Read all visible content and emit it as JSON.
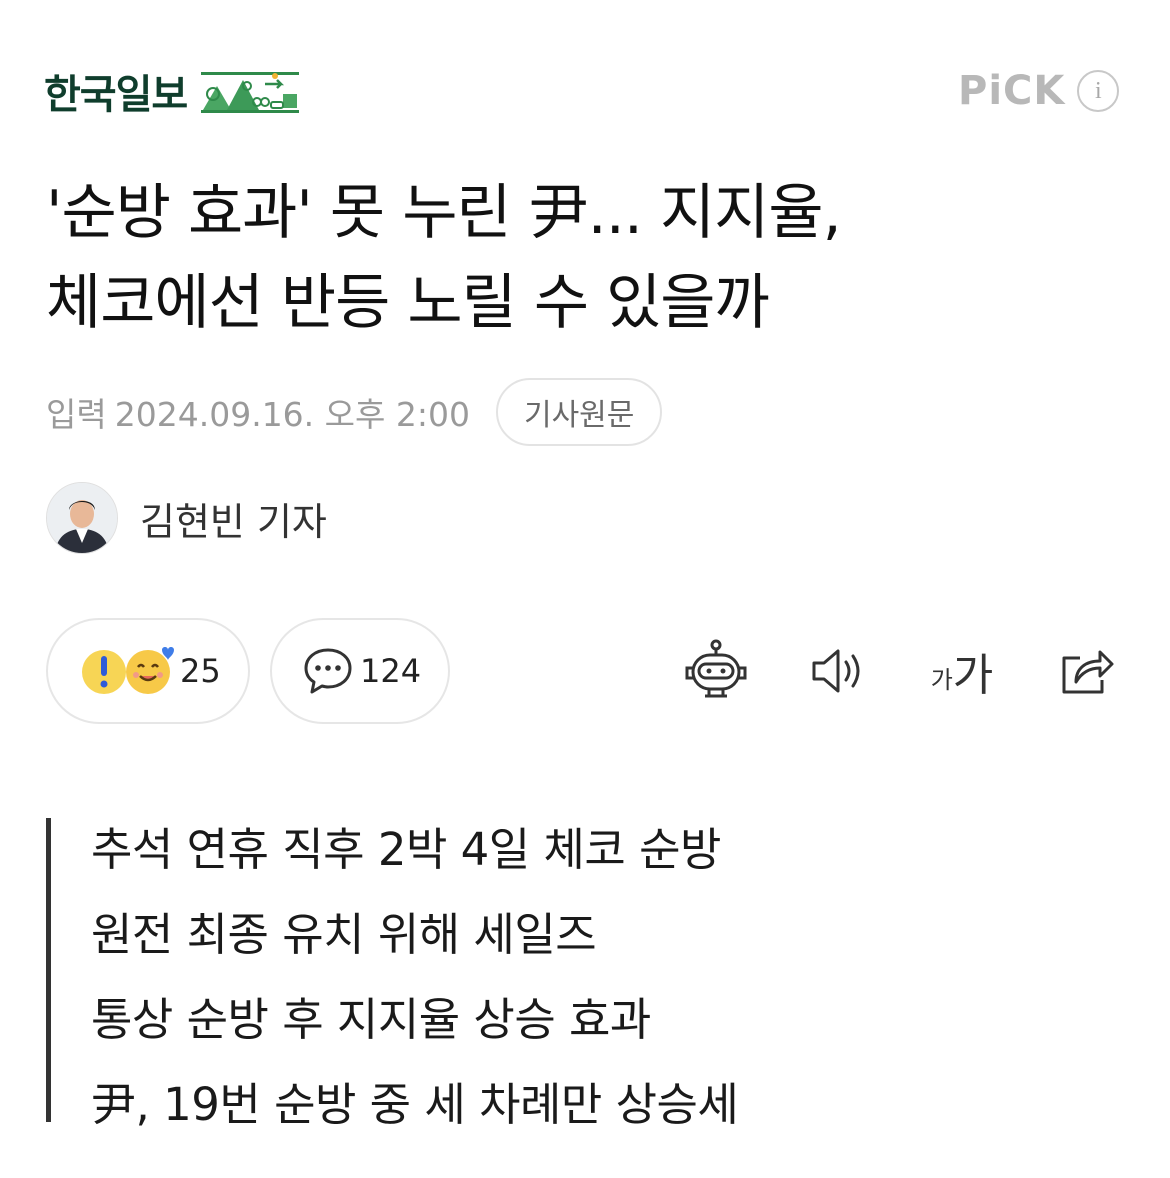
{
  "header": {
    "publisher": "한국일보",
    "pick_label": "PiCK",
    "info_icon": "info-icon",
    "info_glyph": "i"
  },
  "article": {
    "headline_line1": "'순방 효과' 못 누린 尹... 지지율,",
    "headline_line2": "체코에선 반등 노릴 수 있을까",
    "date_label": "입력",
    "date_value": "2024.09.16. 오후 2:00",
    "original_button": "기사원문",
    "author": "김현빈 기자"
  },
  "actions": {
    "reaction_count": "25",
    "comment_count": "124",
    "font_small": "가",
    "font_big": "가"
  },
  "summary": [
    "추석 연휴 직후 2박 4일 체코 순방",
    "원전 최종 유치 위해 세일즈",
    "통상 순방 후 지지율 상승 효과",
    "尹, 19번 순방 중 세 차례만 상승세"
  ],
  "colors": {
    "brand_green": "#0f3d2c",
    "pick_gray": "#b8b8b8",
    "text_dark": "#111111",
    "meta_gray": "#9a9a9a"
  }
}
